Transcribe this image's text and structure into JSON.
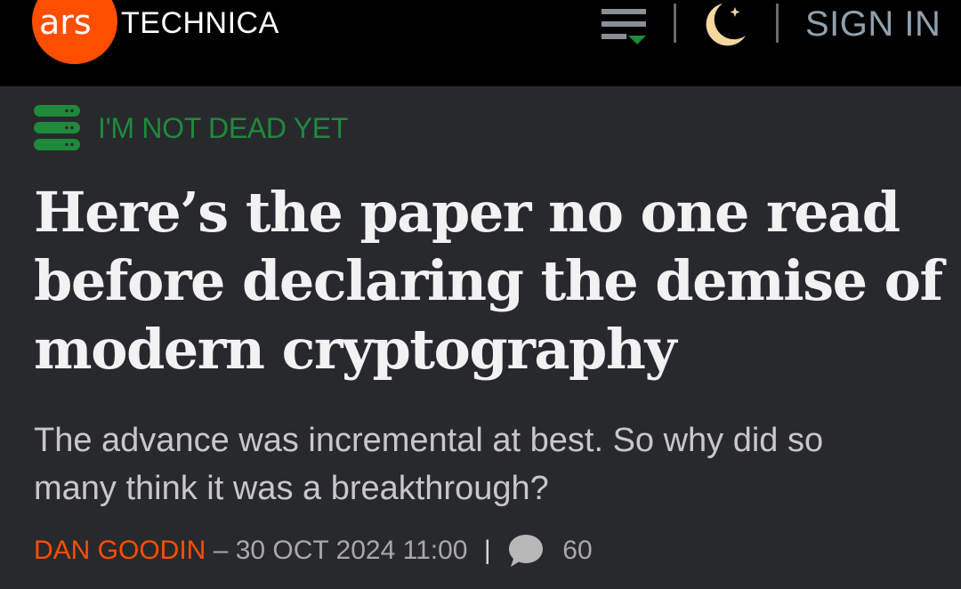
{
  "header": {
    "logo": {
      "ars": "ars",
      "technica": "TECHNICA"
    },
    "menu_icon": "hamburger-menu-icon",
    "theme_icon": "moon-star-icon",
    "sign_in_label": "SIGN IN",
    "colors": {
      "brand_orange": "#ff4e00",
      "menu_accent": "#1f8a3c",
      "moon": "#f6d7a0",
      "sign_in": "#8fa0ad"
    }
  },
  "article": {
    "section_icon": "server-stack-icon",
    "section_label": "I'M NOT DEAD YET",
    "headline_lines": [
      "Here’s the paper no one read",
      "before declaring the demise of",
      "modern cryptography"
    ],
    "dek_lines": [
      "The advance was incremental at best. So why did so",
      "many think it was a breakthrough?"
    ],
    "byline": {
      "author": "DAN GOODIN",
      "date_prefix": " – 30 OCT 2024 11:00",
      "separator": "|",
      "comment_icon": "comment-bubble-icon",
      "comment_count": "60"
    },
    "colors": {
      "section_green": "#1f8a3c",
      "headline": "#f2f2f2",
      "author_orange": "#ff4e00"
    }
  }
}
